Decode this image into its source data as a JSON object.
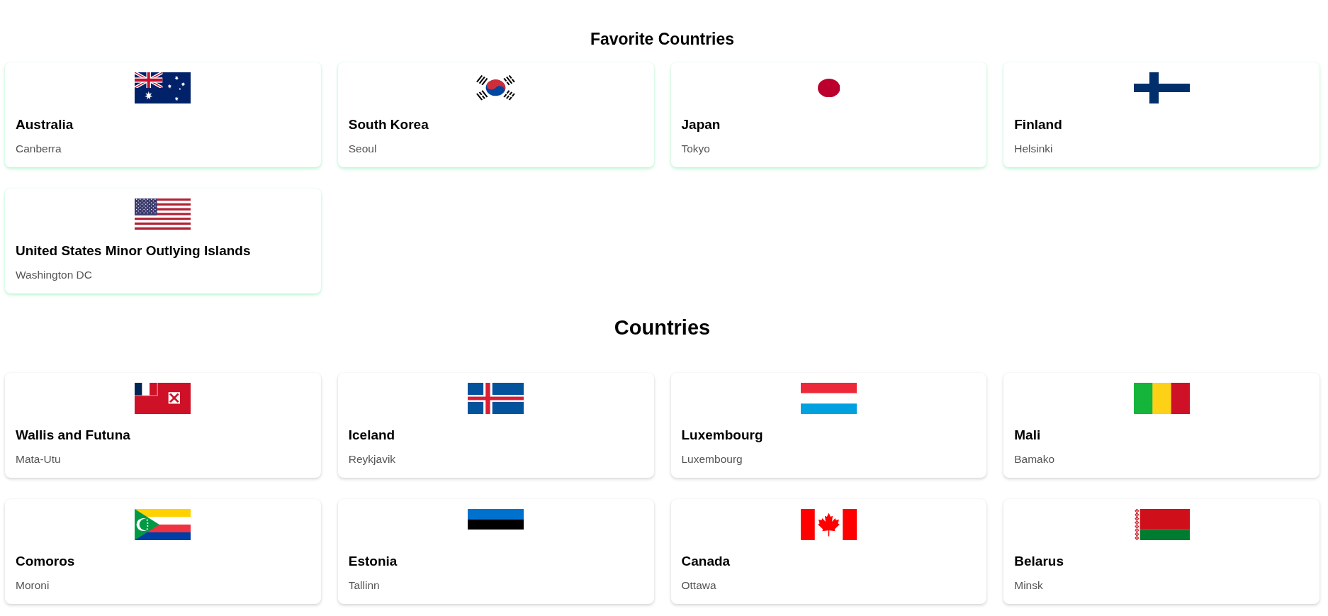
{
  "sections": [
    {
      "title": "Favorite Countries",
      "favorite": true,
      "countries": [
        {
          "name": "Australia",
          "capital": "Canberra",
          "kind": "au"
        },
        {
          "name": "South Korea",
          "capital": "Seoul",
          "kind": "kr"
        },
        {
          "name": "Japan",
          "capital": "Tokyo",
          "kind": "jp"
        },
        {
          "name": "Finland",
          "capital": "Helsinki",
          "kind": "fi"
        },
        {
          "name": "United States Minor Outlying Islands",
          "capital": "Washington DC",
          "kind": "um"
        }
      ]
    },
    {
      "title": "Countries",
      "favorite": false,
      "countries": [
        {
          "name": "Wallis and Futuna",
          "capital": "Mata-Utu",
          "kind": "wf"
        },
        {
          "name": "Iceland",
          "capital": "Reykjavik",
          "kind": "is"
        },
        {
          "name": "Luxembourg",
          "capital": "Luxembourg",
          "kind": "lu"
        },
        {
          "name": "Mali",
          "capital": "Bamako",
          "kind": "ml"
        },
        {
          "name": "Comoros",
          "capital": "Moroni",
          "kind": "km"
        },
        {
          "name": "Estonia",
          "capital": "Tallinn",
          "kind": "ee"
        },
        {
          "name": "Canada",
          "capital": "Ottawa",
          "kind": "ca"
        },
        {
          "name": "Belarus",
          "capital": "Minsk",
          "kind": "by"
        }
      ]
    }
  ]
}
